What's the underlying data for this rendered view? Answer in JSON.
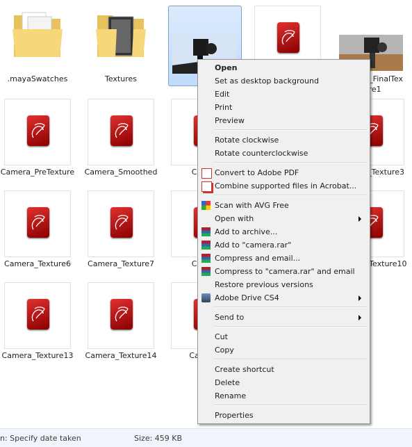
{
  "files": [
    {
      "label": "Camera_PreTexture",
      "kind": "maya"
    },
    {
      "label": "Camera_Smoothed",
      "kind": "maya"
    },
    {
      "label": "Camer",
      "kind": "maya"
    },
    {
      "label": "",
      "kind": "maya"
    },
    {
      "label": "Camera_Texture3",
      "kind": "maya"
    },
    {
      "label": "Camera_Texture6",
      "kind": "maya"
    },
    {
      "label": "Camera_Texture7",
      "kind": "maya"
    },
    {
      "label": "Camer",
      "kind": "maya"
    },
    {
      "label": "",
      "kind": "maya"
    },
    {
      "label": "Camera_Texture10",
      "kind": "maya"
    },
    {
      "label": "Camera_Texture13",
      "kind": "maya"
    },
    {
      "label": "Camera_Texture14",
      "kind": "maya"
    },
    {
      "label": "Camera",
      "kind": "maya"
    }
  ],
  "top_row": {
    "folder1": ".mayaSwatches",
    "folder2": "Textures",
    "selected": "ca",
    "render": "Camera_FinalTexture1"
  },
  "menu": {
    "open": "Open",
    "desktop_bg": "Set as desktop background",
    "edit": "Edit",
    "print": "Print",
    "preview": "Preview",
    "rotate_cw": "Rotate clockwise",
    "rotate_ccw": "Rotate counterclockwise",
    "convert_pdf": "Convert to Adobe PDF",
    "combine": "Combine supported files in Acrobat...",
    "avg": "Scan with AVG Free",
    "open_with": "Open with",
    "add_archive": "Add to archive...",
    "add_rar": "Add to \"camera.rar\"",
    "compress_email": "Compress and email...",
    "compress_rar_email": "Compress to \"camera.rar\" and email",
    "restore": "Restore previous versions",
    "adobe_drive": "Adobe Drive CS4",
    "send_to": "Send to",
    "cut": "Cut",
    "copy": "Copy",
    "shortcut": "Create shortcut",
    "delete": "Delete",
    "rename": "Rename",
    "properties": "Properties"
  },
  "status": {
    "date": "n: Specify date taken",
    "size": "Size: 459 KB"
  }
}
